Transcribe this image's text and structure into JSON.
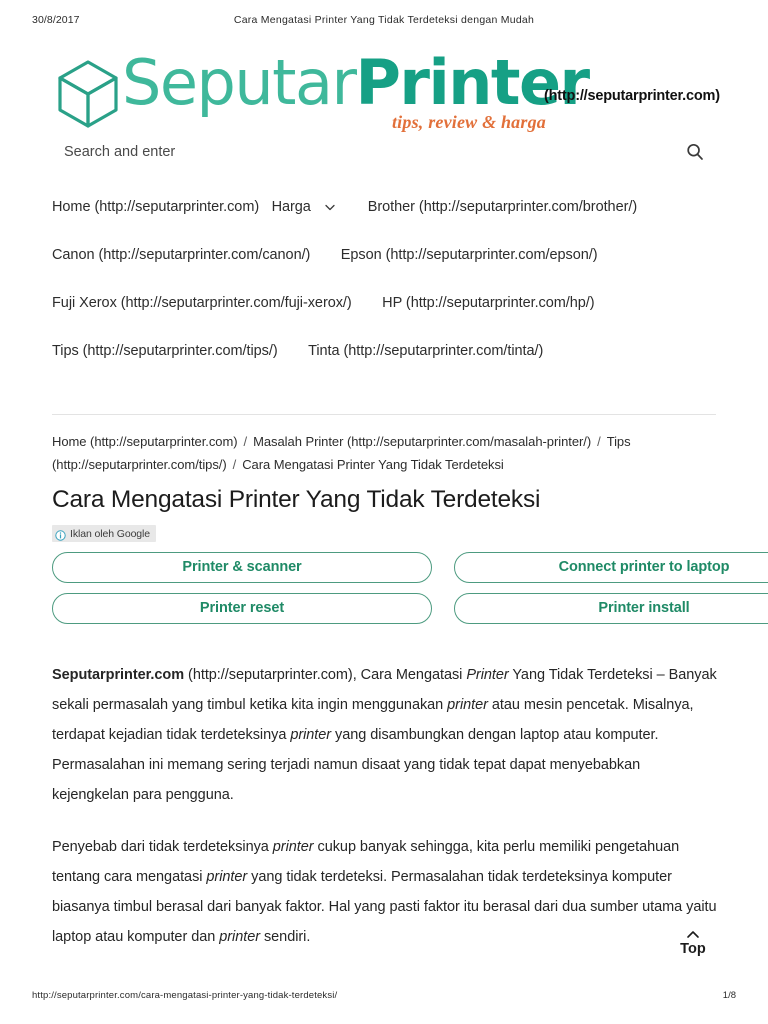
{
  "print": {
    "date": "30/8/2017",
    "doc_title": "Cara Mengatasi Printer Yang Tidak Terdeteksi dengan Mudah",
    "footer_url": "http://seputarprinter.com/cara-mengatasi-printer-yang-tidak-terdeteksi/",
    "page_number": "1/8"
  },
  "brand": {
    "word_part1": "Seputar",
    "word_part2": "Printer",
    "tagline": "tips, review & harga",
    "site_url": "(http://seputarprinter.com)",
    "logo_icon": "cube-icon",
    "colors": {
      "teal_light": "#3fb89b",
      "teal_dark": "#16a085",
      "orange": "#e2703a",
      "ad_green": "#1f8a66",
      "ad_border": "#4d9b80"
    }
  },
  "search": {
    "placeholder": "Search and enter",
    "value": "",
    "icon": "search-icon"
  },
  "nav": {
    "rows": [
      [
        {
          "label": "Home (http://seputarprinter.com)",
          "caret": false
        },
        {
          "label": "Harga",
          "caret": true
        },
        {
          "label": "Brother (http://seputarprinter.com/brother/)",
          "caret": false
        }
      ],
      [
        {
          "label": "Canon (http://seputarprinter.com/canon/)",
          "caret": false
        },
        {
          "label": "Epson (http://seputarprinter.com/epson/)",
          "caret": false
        }
      ],
      [
        {
          "label": "Fuji Xerox (http://seputarprinter.com/fuji-xerox/)",
          "caret": false
        },
        {
          "label": "HP (http://seputarprinter.com/hp/)",
          "caret": false
        }
      ],
      [
        {
          "label": "Tips (http://seputarprinter.com/tips/)",
          "caret": false
        },
        {
          "label": "Tinta (http://seputarprinter.com/tinta/)",
          "caret": false
        }
      ]
    ]
  },
  "breadcrumb": {
    "separator": "/",
    "items": [
      "Home (http://seputarprinter.com)",
      "Masalah Printer (http://seputarprinter.com/masalah-printer/)",
      "Tips (http://seputarprinter.com/tips/)",
      "Cara Mengatasi Printer Yang Tidak Terdeteksi"
    ]
  },
  "article": {
    "title": "Cara Mengatasi Printer Yang Tidak Terdeteksi",
    "paragraph1": {
      "lead_bold": "Seputarprinter.com",
      "lead_url": "(http://seputarprinter.com)",
      "seg_a": ", Cara Mengatasi ",
      "em_a": "Printer",
      "seg_b": " Yang Tidak Terdeteksi – Banyak sekali permasalah yang timbul ketika kita ingin menggunakan ",
      "em_b": "printer",
      "seg_c": " atau mesin pencetak. Misalnya, terdapat kejadian tidak terdeteksinya ",
      "em_c": "printer",
      "seg_d": " yang disambungkan dengan laptop atau komputer. Permasalahan ini memang sering terjadi namun disaat yang tidak tepat dapat menyebabkan kejengkelan para pengguna."
    },
    "paragraph2": {
      "seg_a": "Penyebab dari tidak terdeteksinya ",
      "em_a": "printer",
      "seg_b": " cukup banyak sehingga, kita perlu memiliki pengetahuan tentang cara mengatasi ",
      "em_b": "printer",
      "seg_c": " yang tidak terdeteksi. Permasalahan tidak terdeteksinya komputer biasanya timbul berasal dari banyak faktor. Hal yang pasti faktor itu berasal dari dua sumber utama yaitu laptop atau komputer dan ",
      "em_c": "printer",
      "seg_d": " sendiri."
    }
  },
  "ads": {
    "label": "Iklan oleh Google",
    "info_icon": "info-icon",
    "left_column": [
      "Printer & scanner",
      "Printer reset"
    ],
    "right_column": [
      "Connect printer to laptop",
      "Printer install"
    ]
  },
  "back_to_top": {
    "label": "Top",
    "icon": "chevron-up-icon"
  }
}
